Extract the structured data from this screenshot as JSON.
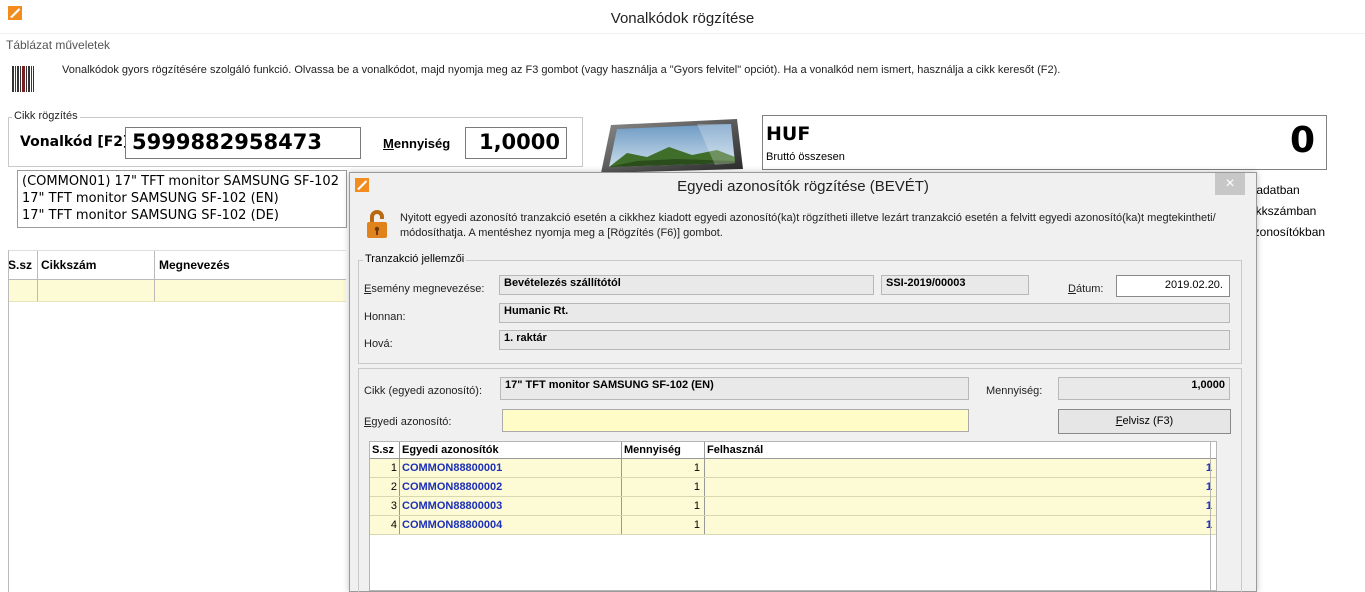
{
  "window": {
    "title": "Vonalkódok rögzítése"
  },
  "menu": {
    "tables": "Táblázat műveletek"
  },
  "info_text": "Vonalkódok gyors rögzítésére szolgáló funkció. Olvassa be a vonalkódot, majd nyomja meg az F3 gombot (vagy használja a \"Gyors felvitel\" opciót). Ha a vonalkód nem ismert, használja a cikk keresőt (F2).",
  "cikk_rogzites": {
    "label": "Cikk rögzítés",
    "barcode_label": "Vonalkód [F2]",
    "barcode_value": "5999882958473",
    "qty_label": "Mennyiség",
    "qty_value": "1,0000"
  },
  "totals": {
    "currency": "HUF",
    "caption": "Bruttó összesen",
    "value": "0"
  },
  "product_list": [
    "(COMMON01) 17\" TFT monitor SAMSUNG SF-102",
    "17\" TFT monitor SAMSUNG SF-102 (EN)",
    "17\" TFT monitor SAMSUNG SF-102 (DE)"
  ],
  "right_options": [
    "k adatban",
    "cikkszámban",
    "azonosítókban"
  ],
  "main_table": {
    "headers": [
      "S.sz",
      "Cikkszám",
      "Megnevezés"
    ]
  },
  "dialog": {
    "title": "Egyedi azonosítók rögzítése (BEVÉT)",
    "close": "×",
    "info": "Nyitott egyedi azonosító tranzakció esetén a cikkhez kiadott egyedi azonosító(ka)t rögzítheti illetve lezárt tranzakció esetén  a felvitt egyedi azonosító(ka)t megtekintheti/ módosíthatja. A mentéshez nyomja meg a [Rögzítés (F6)] gombot.",
    "tr_group_label": "Tranzakció jellemzői",
    "event_label": "Esemény megnevezése:",
    "event_value": "Bevételezés szállítótól",
    "doc_number": "SSI-2019/00003",
    "date_label": "Dátum:",
    "date_value": "2019.02.20.",
    "from_label": "Honnan:",
    "from_value": "Humanic Rt.",
    "to_label": "Hová:",
    "to_value": "1. raktár",
    "item_label": "Cikk (egyedi azonosító):",
    "item_value": "17\" TFT monitor SAMSUNG SF-102 (EN)",
    "qty_label": "Mennyiség:",
    "qty_value": "1,0000",
    "unique_id_label": "Egyedi azonosító:",
    "add_button": "Felvisz (F3)",
    "grid": {
      "headers": [
        "S.sz",
        "Egyedi azonosítók",
        "Mennyiség",
        "Felhasznál"
      ],
      "rows": [
        {
          "n": "1",
          "id": "COMMON88800001",
          "qty": "1",
          "used": "1"
        },
        {
          "n": "2",
          "id": "COMMON88800002",
          "qty": "1",
          "used": "1"
        },
        {
          "n": "3",
          "id": "COMMON88800003",
          "qty": "1",
          "used": "1"
        },
        {
          "n": "4",
          "id": "COMMON88800004",
          "qty": "1",
          "used": "1"
        }
      ]
    }
  },
  "icons": [
    "app-icon",
    "barcode-icon",
    "monitor-image",
    "lock-icon",
    "close-icon"
  ],
  "colors": {
    "accent": "#f28c1e",
    "highlight_row": "#fdfbd5",
    "id_blue": "#1c2fb8",
    "input_yellow": "#fffcc8"
  }
}
